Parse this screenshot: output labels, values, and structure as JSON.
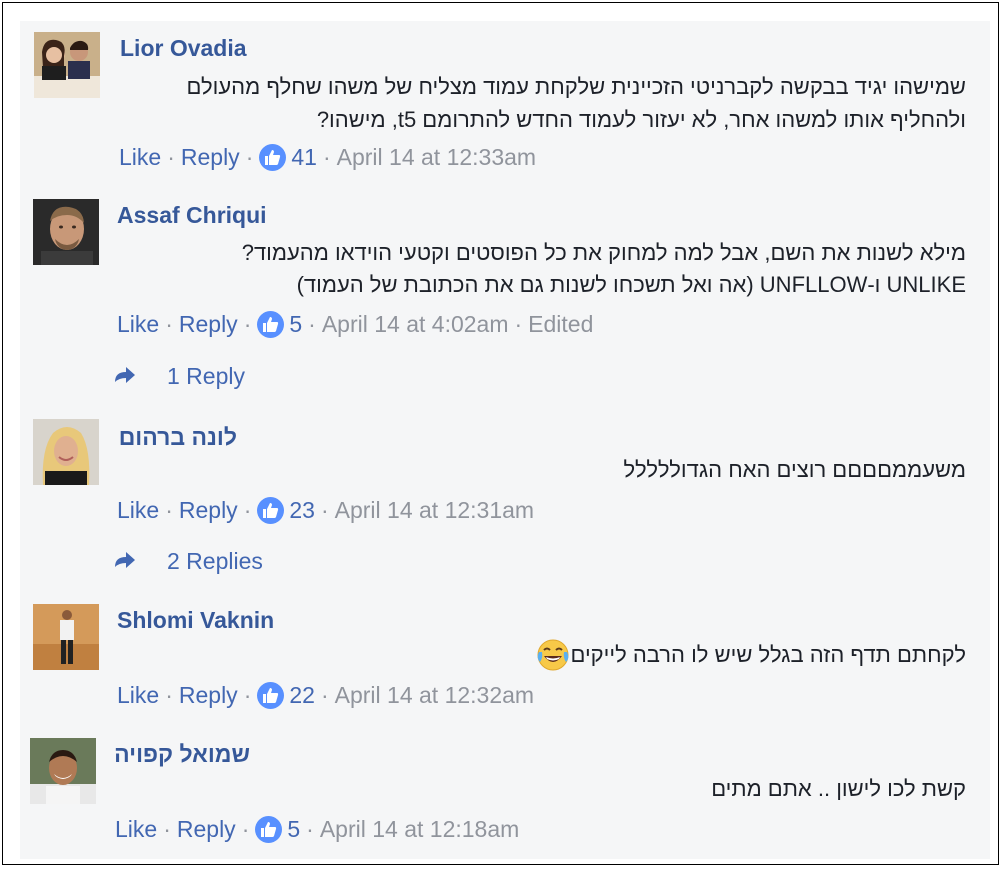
{
  "comments": [
    {
      "author": "Lior Ovadia",
      "avatar": "photo-couple",
      "lines": [
        "שמישהו יגיד בבקשה לקברניטי הזכיינית שלקחת עמוד מצליח של משהו שחלף מהעולם",
        "ולהחליף אותו למשהו אחר, לא יעזור לעמוד החדש להתרומם t5, מישהו?"
      ],
      "like_label": "Like",
      "reply_label": "Reply",
      "likes": "41",
      "time": "April 14 at 12:33am"
    },
    {
      "author": "Assaf Chriqui",
      "avatar": "photo-man-dark",
      "lines": [
        "מילא לשנות את השם, אבל למה למחוק את כל הפוסטים וקטעי הוידאו מהעמוד?",
        "UNLIKE ו-UNFLLOW (אה ואל תשכחו לשנות גם את הכתובת של העמוד)"
      ],
      "like_label": "Like",
      "reply_label": "Reply",
      "likes": "5",
      "time": "April 14 at 4:02am",
      "edited": "Edited",
      "replies_label": "1 Reply"
    },
    {
      "author": "לונה ברהום",
      "avatar": "photo-woman-blonde",
      "lines": [
        "משעממםםםם רוצים האח הגדוללללל"
      ],
      "like_label": "Like",
      "reply_label": "Reply",
      "likes": "23",
      "time": "April 14 at 12:31am",
      "replies_label": "2 Replies"
    },
    {
      "author": "Shlomi Vaknin",
      "avatar": "photo-man-standing",
      "lines": [
        "לקחתם תדף הזה בגלל שיש לו הרבה לייקים"
      ],
      "emoji": "tears-of-joy",
      "like_label": "Like",
      "reply_label": "Reply",
      "likes": "22",
      "time": "April 14 at 12:32am"
    },
    {
      "author": "שמואל קפויה",
      "avatar": "photo-man-smiling",
      "lines": [
        "קשת לכו לישון .. אתם מתים"
      ],
      "like_label": "Like",
      "reply_label": "Reply",
      "likes": "5",
      "time": "April 14 at 12:18am"
    }
  ],
  "colors": {
    "link": "#4267b2",
    "name": "#365899",
    "meta": "#90949c",
    "badge": "#5890ff",
    "panel": "#f5f6f7"
  }
}
